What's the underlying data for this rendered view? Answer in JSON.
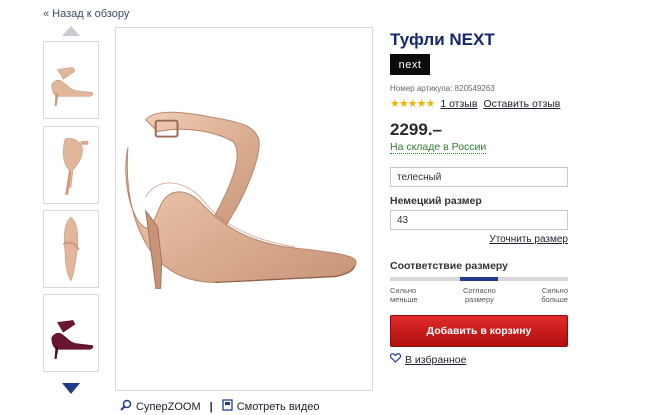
{
  "nav": {
    "back_label": "« Назад к обзору"
  },
  "gallery": {
    "thumbnails": [
      {
        "alt": "beige-shoe-side"
      },
      {
        "alt": "beige-shoe-back"
      },
      {
        "alt": "beige-shoe-top"
      },
      {
        "alt": "burgundy-shoe-side"
      }
    ],
    "zoom_label": "СуперZOOM",
    "video_label": "Смотреть видео"
  },
  "product": {
    "title": "Туфли NEXT",
    "brand_logo": "next",
    "sku": "Номер артикула: 820549263",
    "rating": {
      "stars": 5,
      "stars_text": "★★★★★",
      "reviews_label": "1 отзыв",
      "write_review_label": "Оставить отзыв"
    },
    "price": "2299.–",
    "stock": "На складе в России",
    "color_value": "телесный",
    "size_label": "Немецкий размер",
    "size_value": "43",
    "clarify_size_label": "Уточнить размер",
    "fit": {
      "label": "Соответствие размеру",
      "position_pct": 50,
      "scale": [
        {
          "line1": "Сильно",
          "line2": "меньше"
        },
        {
          "line1": "Согласно",
          "line2": "размеру"
        },
        {
          "line1": "Сильно",
          "line2": "больше"
        }
      ]
    },
    "add_to_cart_label": "Добавить в корзину",
    "wishlist_label": "В избранное"
  },
  "colors": {
    "title": "#14296b",
    "accent_blue": "#1f3b8a",
    "stock_green": "#2e7d32",
    "cart_red": "#c51a1a",
    "shoe_nude": "#e2b69a",
    "shoe_burgundy": "#6a1630"
  }
}
